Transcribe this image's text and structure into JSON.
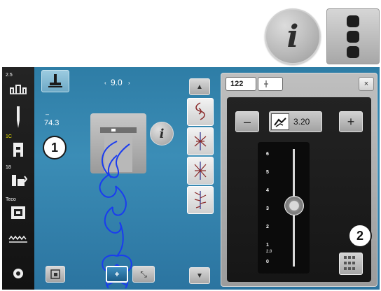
{
  "help": {
    "info_label": "i"
  },
  "sidebar": {
    "items": [
      {
        "num": "2.5",
        "icon": "presser-foot-pressure-icon",
        "num_color": "white"
      },
      {
        "num": "",
        "icon": "needle-icon",
        "num_color": "white"
      },
      {
        "num": "1C",
        "icon": "presser-foot-icon",
        "num_color": "yellow"
      },
      {
        "num": "18",
        "icon": "feed-dog-icon",
        "num_color": "white"
      },
      {
        "num": "Teco",
        "icon": "stitch-plate-icon",
        "num_color": "white"
      },
      {
        "num": "",
        "icon": "thread-tension-icon",
        "num_color": "white"
      },
      {
        "num": "",
        "icon": "setup-circle-icon",
        "num_color": "white"
      }
    ]
  },
  "stitch": {
    "stitch_width": "9.0",
    "stitch_width_left": "‹",
    "stitch_width_right": "›",
    "length_value": "74.3",
    "length_prefix": "–"
  },
  "badges": {
    "one": "1",
    "two": "2"
  },
  "scroll": {
    "up": "▲",
    "down": "▼"
  },
  "bottom_buttons": {
    "add": "+",
    "scale": "⤡"
  },
  "panel": {
    "stitch_number": "122",
    "close": "×",
    "minus": "–",
    "plus": "+",
    "value": "3.20",
    "slider_ticks": [
      "6",
      "5",
      "4",
      "3",
      "2",
      "1",
      "0"
    ],
    "slider_sub_label": "2.0",
    "slider_value": 3.2,
    "slider_max": 6
  },
  "colors": {
    "screen": "#3b8db6",
    "stitch_line": "#1a3cf0",
    "badge_bg": "#ffffff",
    "sidebar_highlight": "#e8e000"
  }
}
